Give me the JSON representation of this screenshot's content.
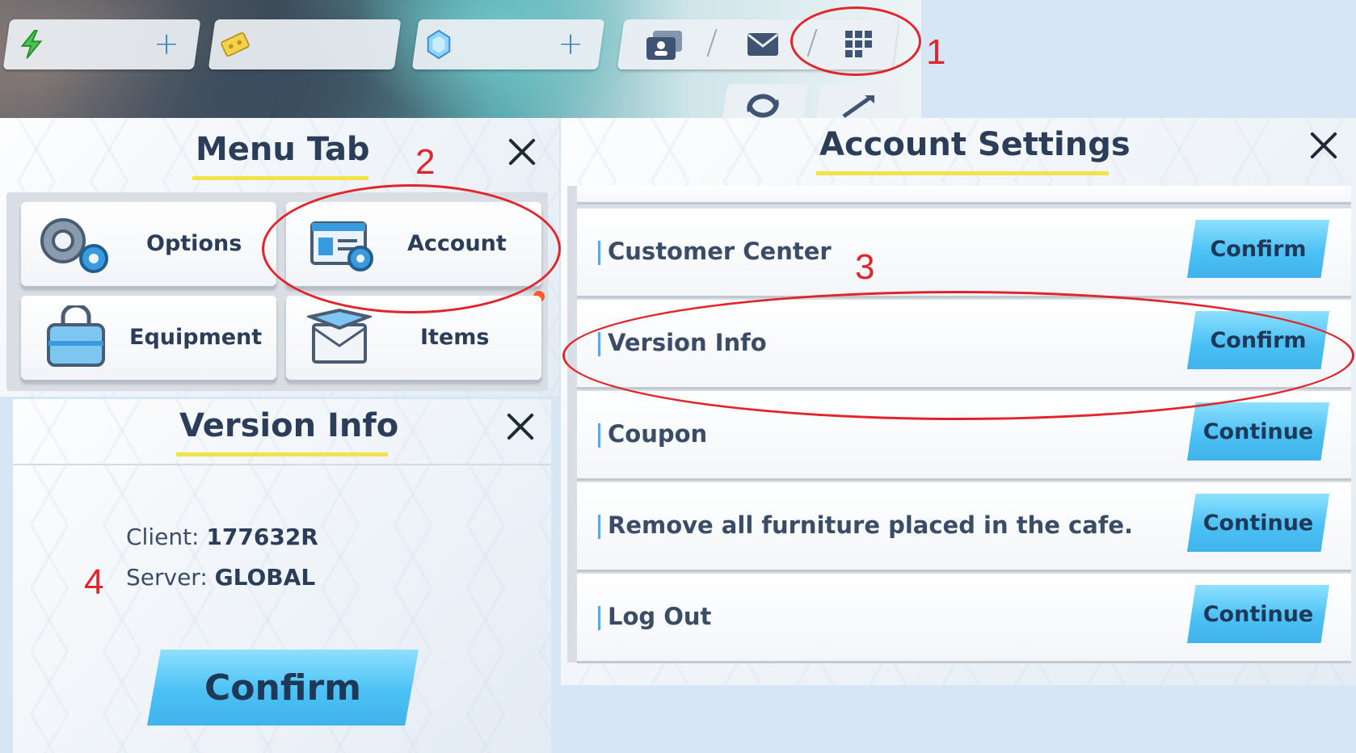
{
  "hud": {
    "currencies": [
      {
        "icon": "energy-icon",
        "has_plus": true
      },
      {
        "icon": "ticket-icon",
        "has_plus": false
      },
      {
        "icon": "gem-icon",
        "has_plus": true
      }
    ],
    "icons": [
      "contacts-icon",
      "mail-icon",
      "menu-grid-icon",
      "refresh-icon",
      "fullscreen-icon"
    ]
  },
  "menu_tab": {
    "title": "Menu Tab",
    "buttons": [
      {
        "label": "Options",
        "icon": "gears-icon"
      },
      {
        "label": "Account",
        "icon": "account-card-icon"
      },
      {
        "label": "Equipment",
        "icon": "bag-icon"
      },
      {
        "label": "Items",
        "icon": "box-icon"
      }
    ]
  },
  "account_settings": {
    "title": "Account Settings",
    "rows": [
      {
        "label": "Customer Center",
        "button": "Confirm"
      },
      {
        "label": "Version Info",
        "button": "Confirm"
      },
      {
        "label": "Coupon",
        "button": "Continue"
      },
      {
        "label": "Remove all furniture placed in the cafe.",
        "button": "Continue"
      },
      {
        "label": "Log Out",
        "button": "Continue"
      }
    ]
  },
  "version_info": {
    "title": "Version Info",
    "client_label": "Client:",
    "client_value": "177632R",
    "server_label": "Server:",
    "server_value": "GLOBAL",
    "confirm_label": "Confirm"
  },
  "annotations": [
    "1",
    "2",
    "3",
    "4"
  ],
  "colors": {
    "accent_blue": "#4cc1f4",
    "title_underline": "#f3e34a",
    "annotation_red": "#e0262c",
    "notification": "#ff5a2a"
  }
}
